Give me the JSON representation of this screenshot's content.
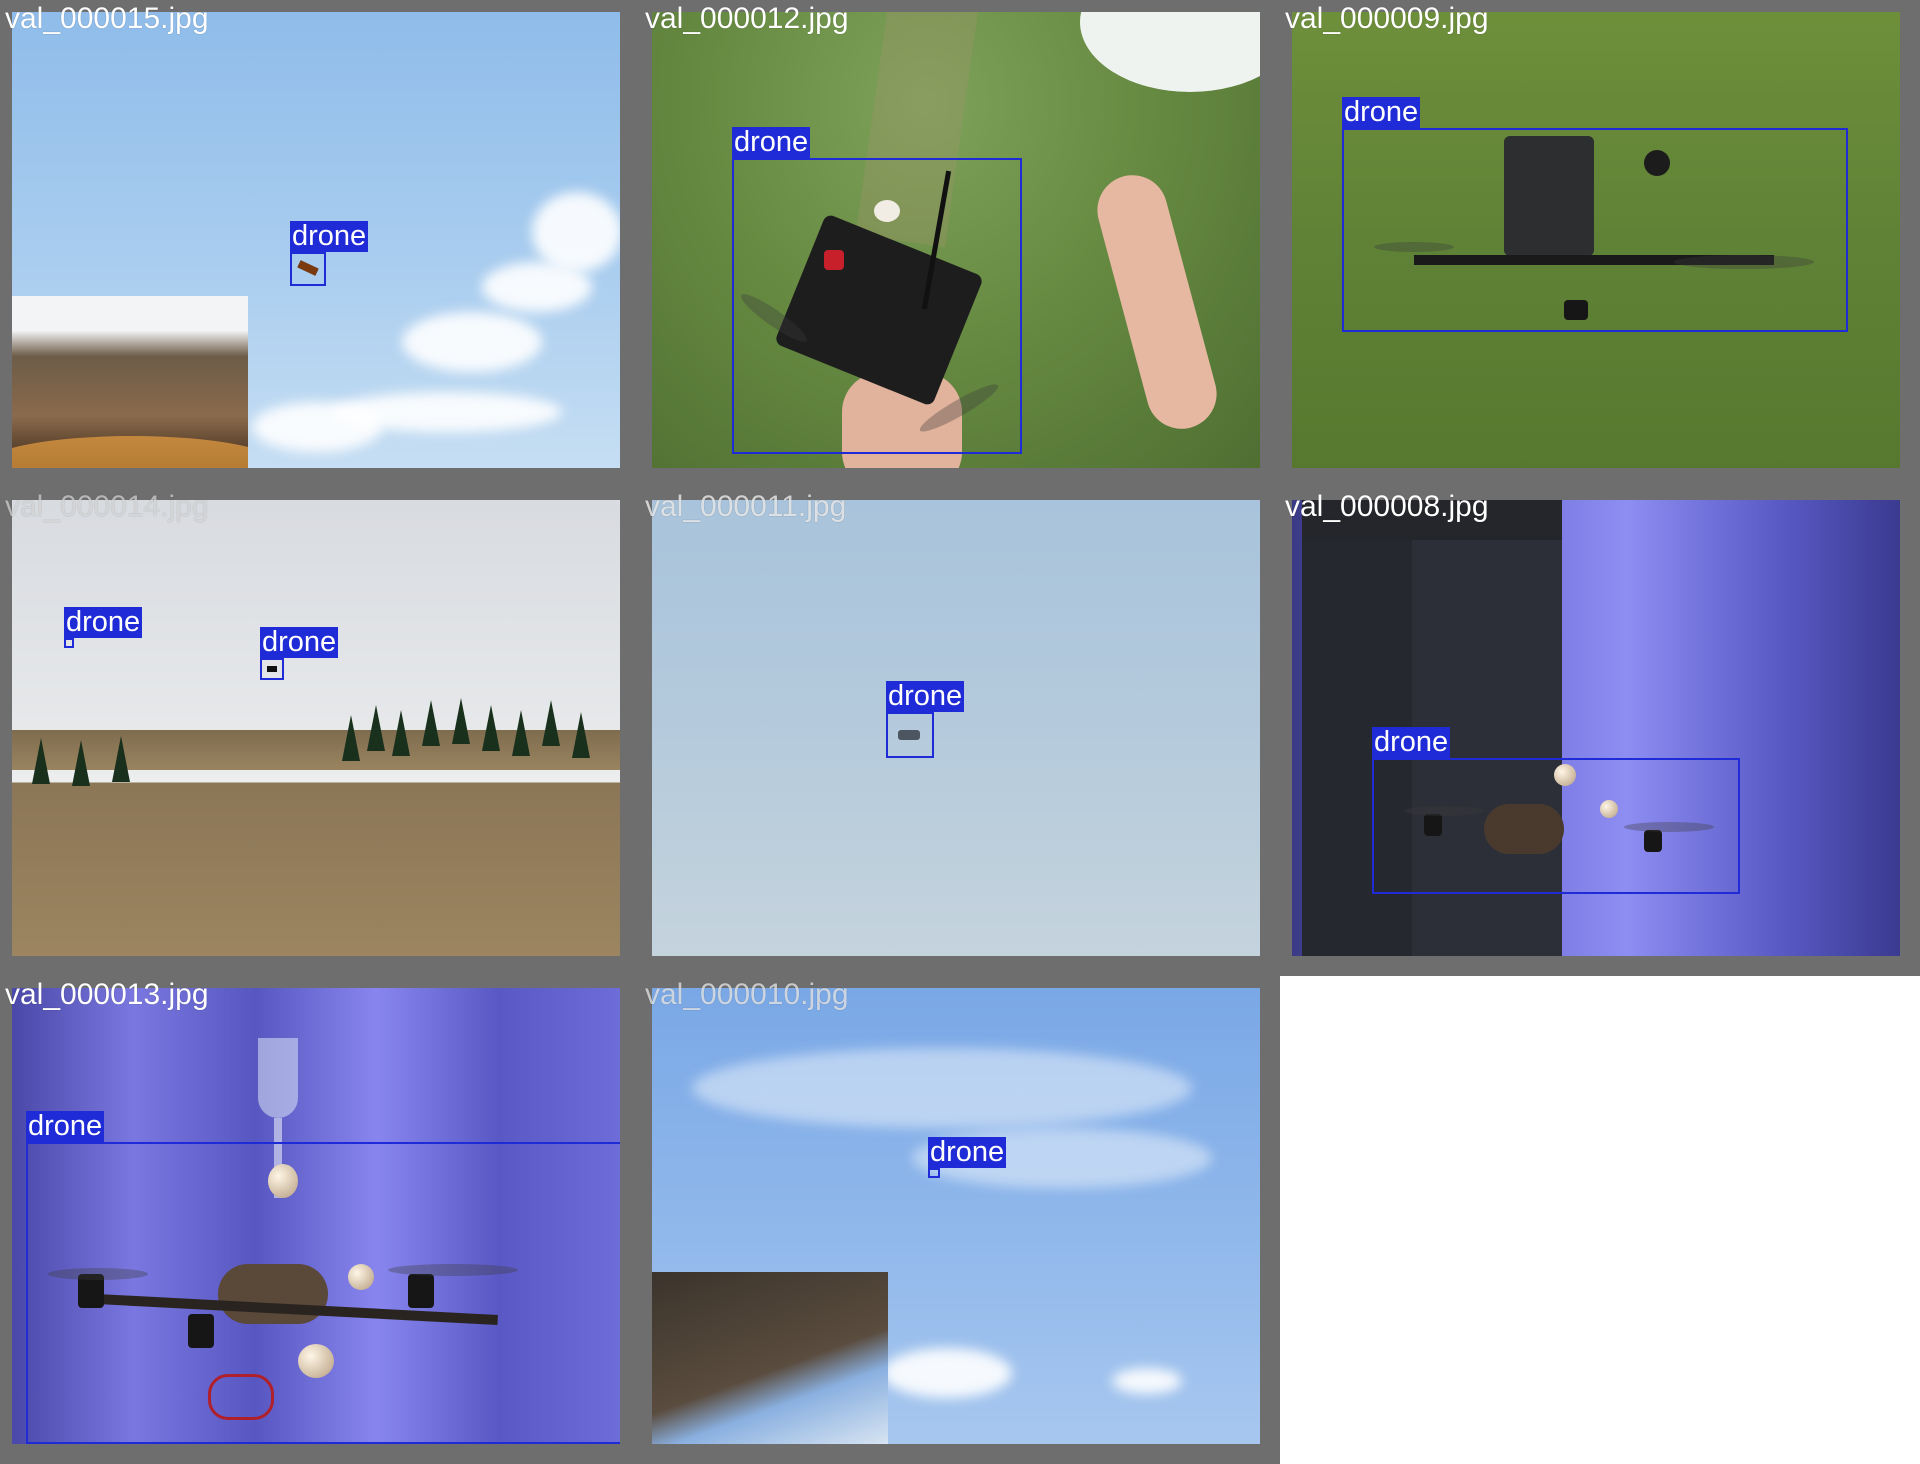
{
  "tiles": [
    {
      "filename": "val_000015.jpg",
      "labels": [
        "drone"
      ]
    },
    {
      "filename": "val_000012.jpg",
      "labels": [
        "drone"
      ]
    },
    {
      "filename": "val_000009.jpg",
      "labels": [
        "drone"
      ]
    },
    {
      "filename": "val_000014.jpg",
      "labels": [
        "drone",
        "drone"
      ]
    },
    {
      "filename": "val_000011.jpg",
      "labels": [
        "drone"
      ]
    },
    {
      "filename": "val_000008.jpg",
      "labels": [
        "drone"
      ]
    },
    {
      "filename": "val_000013.jpg",
      "labels": [
        "drone"
      ]
    },
    {
      "filename": "val_000010.jpg",
      "labels": [
        "drone"
      ]
    }
  ],
  "colors": {
    "box": "#1f2bd6",
    "frame": "#6e6e6e",
    "filename_text": "#ffffff"
  }
}
